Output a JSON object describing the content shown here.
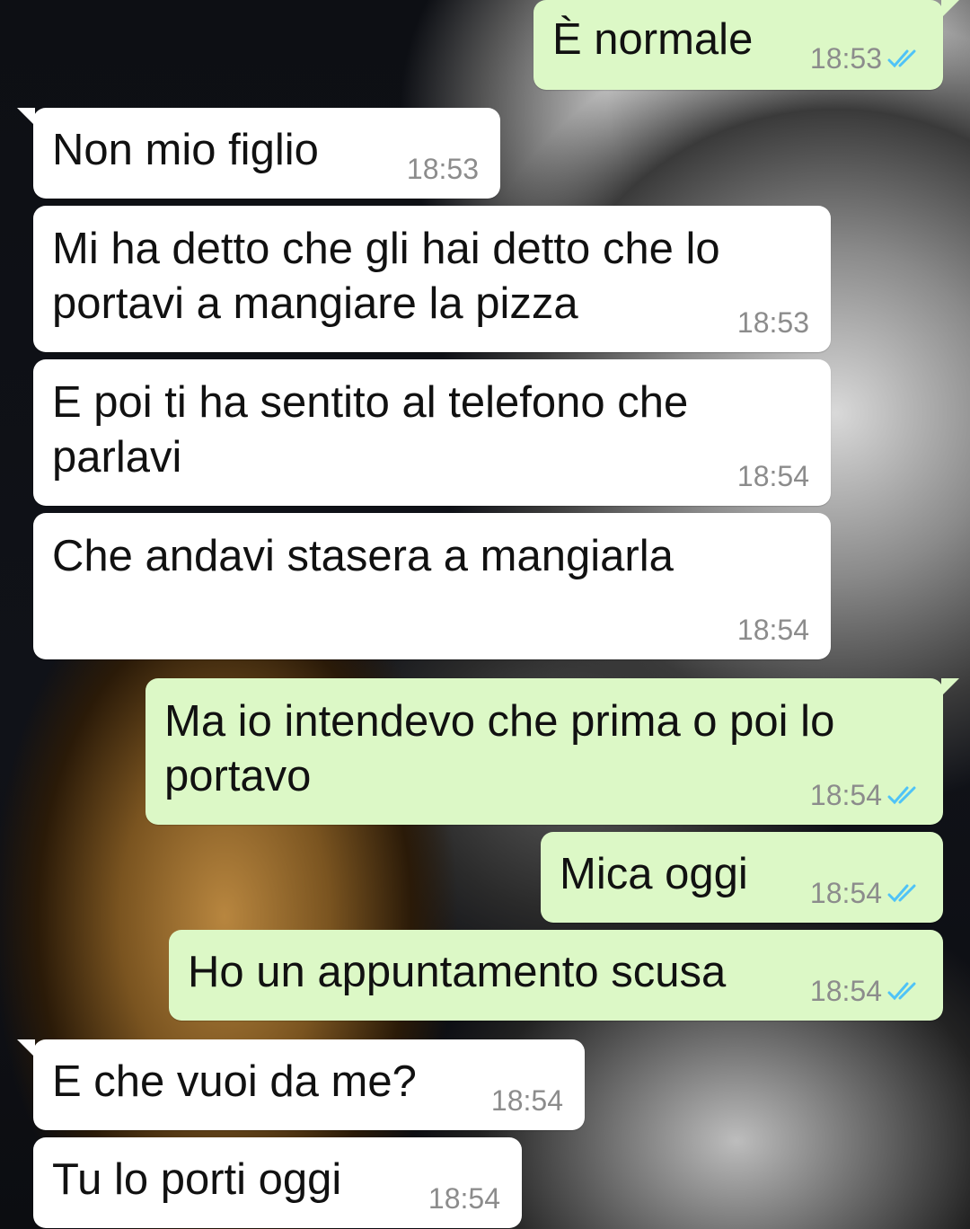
{
  "messages": [
    {
      "dir": "out",
      "text": "È normale",
      "time": "18:53",
      "read": true
    },
    {
      "dir": "in",
      "text": "Non mio figlio",
      "time": "18:53"
    },
    {
      "dir": "in",
      "text_lines": [
        "Mi ha detto che gli hai detto che lo",
        "portavi a mangiare la pizza"
      ],
      "time": "18:53"
    },
    {
      "dir": "in",
      "text_lines": [
        "E poi ti ha sentito al telefono che",
        "parlavi"
      ],
      "time": "18:54"
    },
    {
      "dir": "in",
      "text": "Che andavi stasera a mangiarla",
      "time": "18:54"
    },
    {
      "dir": "out",
      "text_lines": [
        "Ma io intendevo che prima o poi lo",
        "portavo"
      ],
      "time": "18:54",
      "read": true
    },
    {
      "dir": "out",
      "text": "Mica oggi",
      "time": "18:54",
      "read": true
    },
    {
      "dir": "out",
      "text": "Ho un appuntamento scusa",
      "time": "18:54",
      "read": true
    },
    {
      "dir": "in",
      "text": "E che vuoi da me?",
      "time": "18:54"
    },
    {
      "dir": "in",
      "text": "Tu lo porti oggi",
      "time": "18:54"
    }
  ],
  "colors": {
    "incoming_bubble": "#ffffff",
    "outgoing_bubble": "#dcf8c6",
    "timestamp": "#8c8c8c",
    "read_ticks": "#4fc3f7"
  },
  "icons": {
    "read_receipt": "double-check-icon"
  }
}
